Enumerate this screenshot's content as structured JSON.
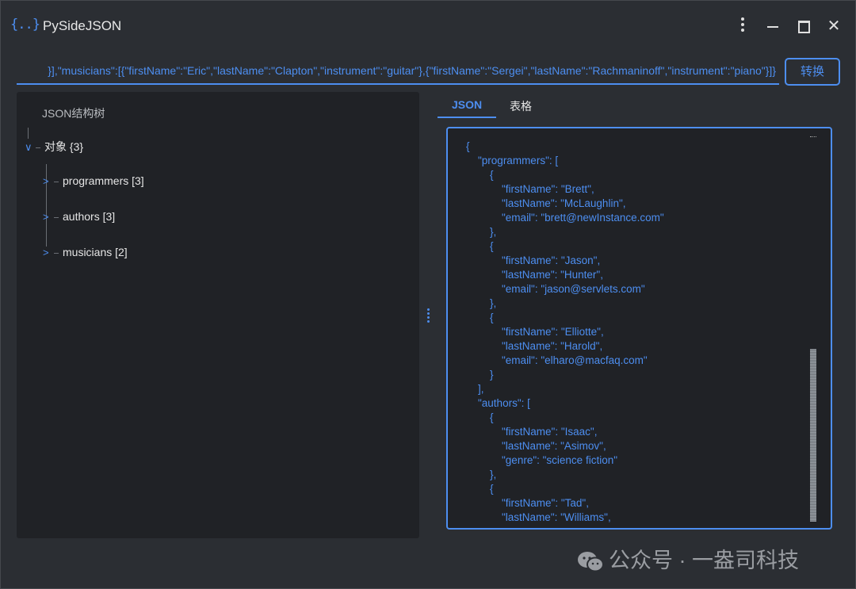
{
  "window": {
    "icon_text": "{..}",
    "title": "PySideJSON"
  },
  "toolbar": {
    "json_input_value": "}],\"musicians\":[{\"firstName\":\"Eric\",\"lastName\":\"Clapton\",\"instrument\":\"guitar\"},{\"firstName\":\"Sergei\",\"lastName\":\"Rachmaninoff\",\"instrument\":\"piano\"}]}",
    "convert_label": "转换"
  },
  "tree": {
    "header": "JSON结构树",
    "root": {
      "chevron": "∨",
      "label": "对象 {3}"
    },
    "children": [
      {
        "chevron": ">",
        "label": "programmers [3]"
      },
      {
        "chevron": ">",
        "label": "authors [3]"
      },
      {
        "chevron": ">",
        "label": "musicians [2]"
      }
    ]
  },
  "tabs": [
    {
      "label": "JSON",
      "active": true
    },
    {
      "label": "表格",
      "active": false
    }
  ],
  "json_view": {
    "text": "{\n    \"programmers\": [\n        {\n            \"firstName\": \"Brett\",\n            \"lastName\": \"McLaughlin\",\n            \"email\": \"brett@newInstance.com\"\n        },\n        {\n            \"firstName\": \"Jason\",\n            \"lastName\": \"Hunter\",\n            \"email\": \"jason@servlets.com\"\n        },\n        {\n            \"firstName\": \"Elliotte\",\n            \"lastName\": \"Harold\",\n            \"email\": \"elharo@macfaq.com\"\n        }\n    ],\n    \"authors\": [\n        {\n            \"firstName\": \"Isaac\",\n            \"lastName\": \"Asimov\",\n            \"genre\": \"science fiction\"\n        },\n        {\n            \"firstName\": \"Tad\",\n            \"lastName\": \"Williams\","
  },
  "watermark": {
    "text": "公众号 · 一盎司科技"
  },
  "colors": {
    "accent": "#4d8ef0",
    "background": "#2b2e33",
    "panel": "#202226"
  }
}
